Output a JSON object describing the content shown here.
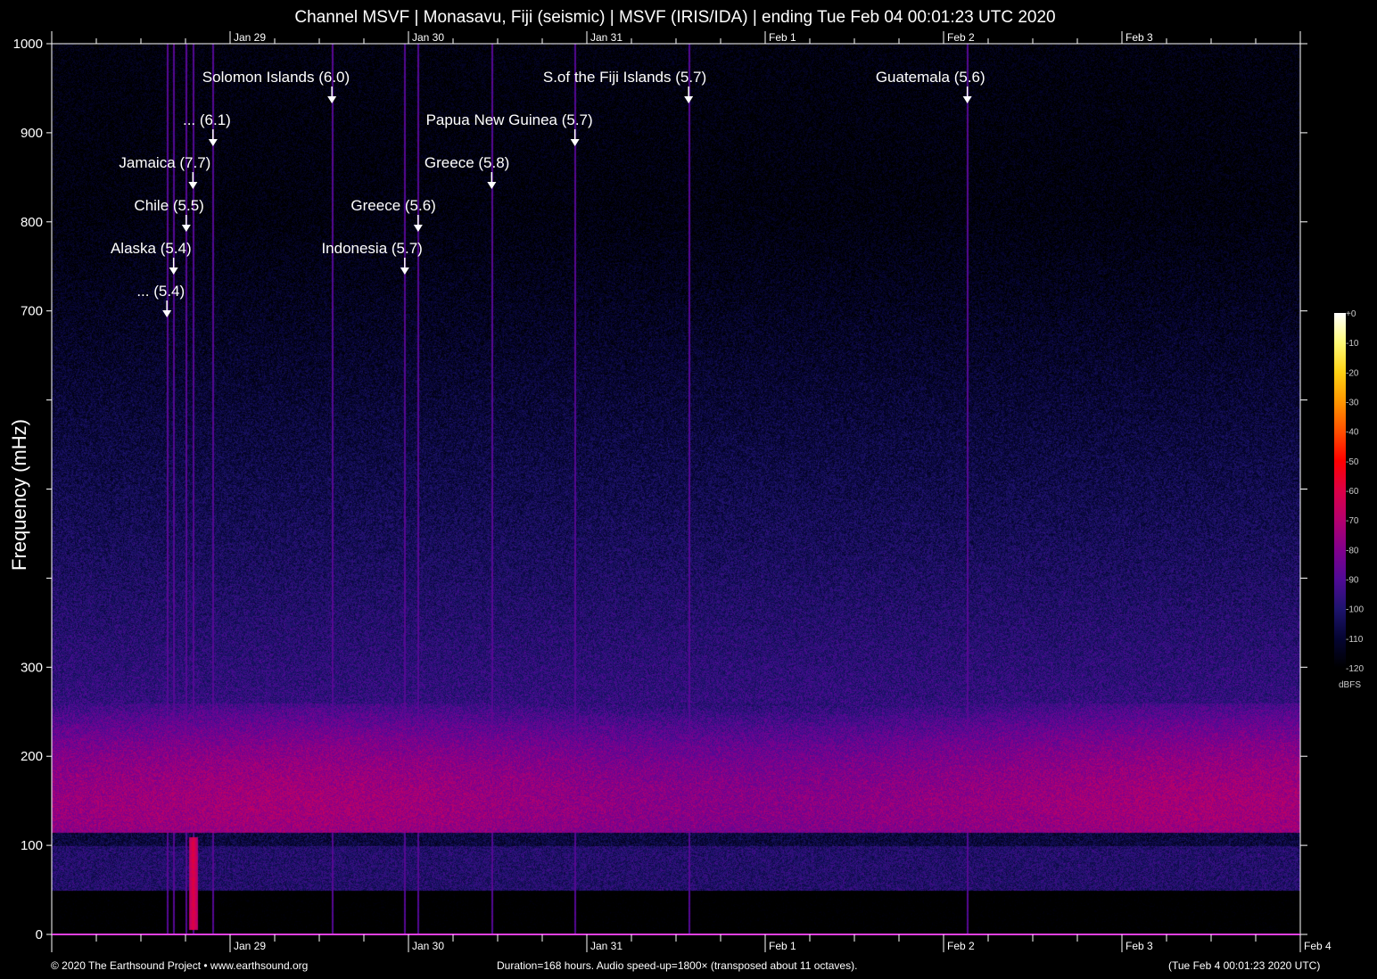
{
  "title": "Channel MSVF | Monasavu, Fiji (seismic) | MSVF (IRIS/IDA) | ending Tue Feb 04 00:01:23 UTC 2020",
  "footer": {
    "left": "© 2020 The Earthsound Project • www.earthsound.org",
    "center": "Duration=168 hours. Audio speed-up=1800× (transposed about 11 octaves).",
    "right": "(Tue Feb  4 00:01:23 2020 UTC)"
  },
  "chart_data": {
    "type": "heatmap",
    "title": "Channel MSVF | Monasavu, Fiji (seismic) | MSVF (IRIS/IDA) | ending Tue Feb 04 00:01:23 UTC 2020",
    "ylabel": "Frequency (mHz)",
    "ylim": [
      0,
      1000
    ],
    "y_ticks": [
      0,
      100,
      200,
      300,
      400,
      500,
      600,
      700,
      800,
      900,
      1000
    ],
    "y_tick_labels": [
      "0",
      "100",
      "200",
      "300",
      "",
      "",
      "",
      "700",
      "800",
      "900",
      "1000"
    ],
    "x_range_hours": [
      0,
      168
    ],
    "x_day_labels": [
      {
        "label": "Jan 29",
        "hour": 24
      },
      {
        "label": "Jan 30",
        "hour": 48
      },
      {
        "label": "Jan 31",
        "hour": 72
      },
      {
        "label": "Feb  1",
        "hour": 96
      },
      {
        "label": "Feb  2",
        "hour": 120
      },
      {
        "label": "Feb  3",
        "hour": 144
      },
      {
        "label": "Feb  4",
        "hour": 168
      }
    ],
    "colorbar": {
      "label": "dBFS",
      "range": [
        -120,
        0
      ],
      "ticks": [
        "+0",
        "-10",
        "-20",
        "-30",
        "-40",
        "-50",
        "-60",
        "-70",
        "-80",
        "-90",
        "-100",
        "-110",
        "-120"
      ]
    },
    "events": [
      {
        "label": "Solomon Islands (6.0)",
        "hour": 37.7
      },
      {
        "label": "S.of the Fiji Islands (5.7)",
        "hour": 85.7
      },
      {
        "label": "Guatemala (5.6)",
        "hour": 123.2
      },
      {
        "label": "... (6.1)",
        "hour": 21.7
      },
      {
        "label": "Papua New Guinea (5.7)",
        "hour": 70.4
      },
      {
        "label": "Jamaica (7.7)",
        "hour": 19.0
      },
      {
        "label": "Greece (5.8)",
        "hour": 59.2
      },
      {
        "label": "Chile (5.5)",
        "hour": 18.1
      },
      {
        "label": "Greece (5.6)",
        "hour": 49.3
      },
      {
        "label": "Alaska (5.4)",
        "hour": 16.4
      },
      {
        "label": "Indonesia (5.7)",
        "hour": 47.5
      },
      {
        "label": "... (5.4)",
        "hour": 15.5
      }
    ]
  }
}
